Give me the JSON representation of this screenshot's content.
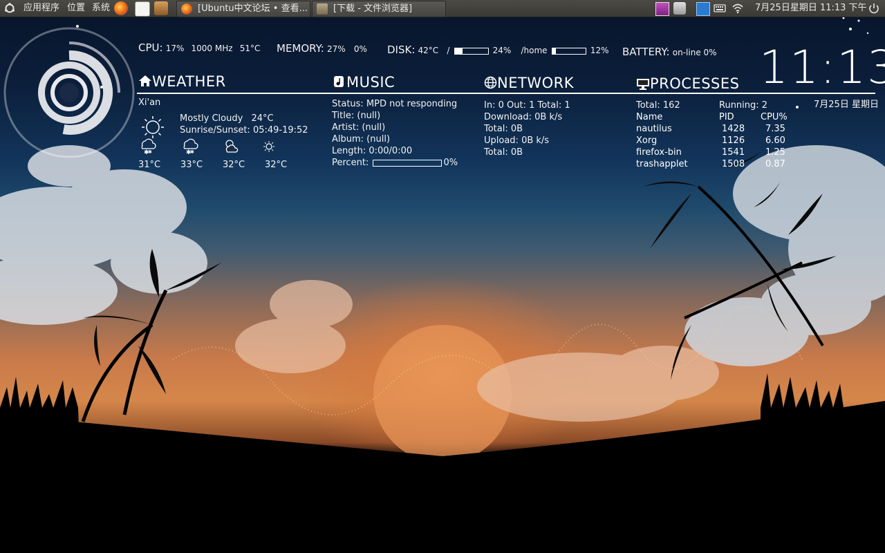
{
  "panel": {
    "menus": [
      "应用程序",
      "位置",
      "系统"
    ],
    "launchers": [
      "firefox-icon",
      "text-editor-icon",
      "mail-rabbit-icon"
    ],
    "tasks": [
      {
        "title": "[Ubuntu中文论坛 • 查看...",
        "icon": "firefox-icon"
      },
      {
        "title": "[下载 - 文件浏览器]",
        "icon": "folder-icon"
      }
    ],
    "clock": "7月25日星期日 11:13 下午"
  },
  "conky": {
    "cpu": {
      "label": "CPU:",
      "percent": "17%",
      "freq": "1000 MHz",
      "temp": "51°C"
    },
    "memory": {
      "label": "MEMORY:",
      "percent": "27%",
      "swap": "0%"
    },
    "disk": {
      "label": "DISK:",
      "temp": "42°C",
      "root_label": "/",
      "root_percent": "24%",
      "root_fill": 0.24,
      "home_label": "/home",
      "home_percent": "12%",
      "home_fill": 0.12
    },
    "battery": {
      "label": "BATTERY:",
      "status": "on-line 0%"
    },
    "clock": "11:13",
    "date": "7月25日 星期日",
    "weather": {
      "heading": "WEATHER",
      "city": "Xi'an",
      "condition": "Mostly Cloudy",
      "temp": "24°C",
      "sun": "Sunrise/Sunset: 05:49-19:52",
      "forecast": [
        {
          "icon": "snow-cloud-icon",
          "temp": "31°C"
        },
        {
          "icon": "snow-cloud-icon",
          "temp": "33°C"
        },
        {
          "icon": "partly-cloudy-icon",
          "temp": "32°C"
        },
        {
          "icon": "sun-icon",
          "temp": "32°C"
        }
      ]
    },
    "music": {
      "heading": "MUSIC",
      "status": "Status: MPD not responding",
      "title": "Title: (null)",
      "artist": "Artist: (null)",
      "album": "Album: (null)",
      "length": "Length: 0:00/0:00",
      "percent_label": "Percent:",
      "percent": "0%",
      "percent_fill": 0
    },
    "network": {
      "heading": "NETWORK",
      "summary": "In: 0  Out: 1  Total: 1",
      "download": "Download: 0B   k/s",
      "download_total": "Total: 0B",
      "upload": "Upload: 0B   k/s",
      "upload_total": "Total: 0B"
    },
    "processes": {
      "heading": "PROCESSES",
      "total": "Total: 162",
      "running": "Running: 2",
      "columns": [
        "Name",
        "PID",
        "CPU%"
      ],
      "rows": [
        {
          "name": "nautilus",
          "pid": "1428",
          "cpu": "7.35"
        },
        {
          "name": "Xorg",
          "pid": "1126",
          "cpu": "6.60"
        },
        {
          "name": "firefox-bin",
          "pid": "1541",
          "cpu": "1.25"
        },
        {
          "name": "trashapplet",
          "pid": "1508",
          "cpu": "0.87"
        }
      ]
    }
  }
}
